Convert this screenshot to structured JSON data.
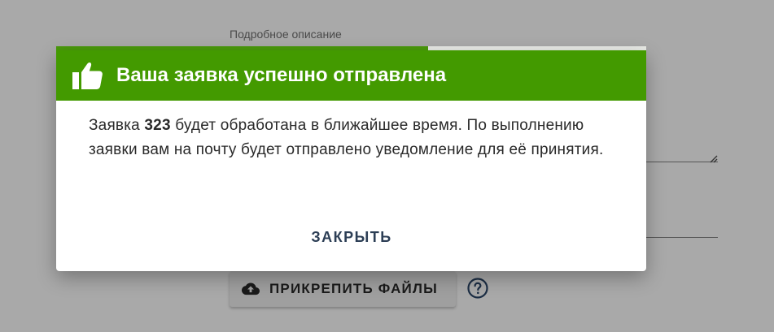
{
  "form": {
    "description_label": "Подробное описание",
    "attach_label": "ПРИКРЕПИТЬ ФАЙЛЫ",
    "progress_fraction": 0.63
  },
  "icons": {
    "attach": "cloud-upload-icon",
    "help": "help-circle-icon",
    "header": "thumbs-up-icon"
  },
  "colors": {
    "header_bg": "#439a00",
    "progress": "#4a9a0b",
    "close_text": "#2c3e55"
  },
  "dialog": {
    "title": "Ваша заявка успешно отправлена",
    "message_prefix": "Заявка ",
    "request_number": "323",
    "message_suffix": " будет обработана в ближайшее время. По выполнению заявки вам на почту будет отправлено уведомление для её принятия.",
    "close_label": "ЗАКРЫТЬ"
  }
}
